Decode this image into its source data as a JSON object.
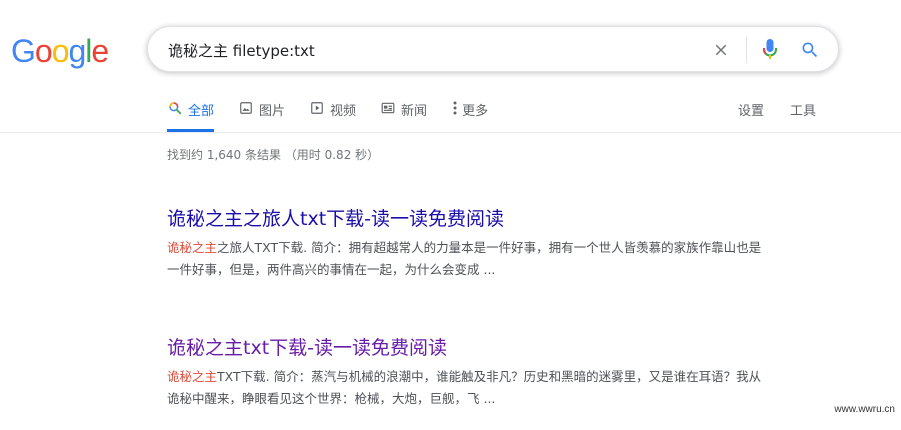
{
  "logo": {
    "letters": [
      {
        "ch": "G",
        "color": "#4285F4"
      },
      {
        "ch": "o",
        "color": "#EA4335"
      },
      {
        "ch": "o",
        "color": "#FBBC05"
      },
      {
        "ch": "g",
        "color": "#4285F4"
      },
      {
        "ch": "l",
        "color": "#34A853"
      },
      {
        "ch": "e",
        "color": "#EA4335"
      }
    ]
  },
  "search": {
    "query": "诡秘之主 filetype:txt",
    "clear_icon": "close-icon",
    "mic_icon": "mic-icon",
    "search_icon": "search-icon"
  },
  "tabs": [
    {
      "label": "全部",
      "icon": "search-icon",
      "active": true
    },
    {
      "label": "图片",
      "icon": "image-icon",
      "active": false
    },
    {
      "label": "视频",
      "icon": "play-icon",
      "active": false
    },
    {
      "label": "新闻",
      "icon": "news-icon",
      "active": false
    },
    {
      "label": "更多",
      "icon": "more-vert-icon",
      "active": false
    }
  ],
  "tools": {
    "settings": "设置",
    "tools": "工具"
  },
  "stats": "找到约 1,640 条结果 （用时 0.82 秒）",
  "results": [
    {
      "title": "诡秘之主之旅人txt下载-读一读免费阅读",
      "snippet_highlight": "诡秘之主",
      "snippet_rest": "之旅人TXT下载. 简介：拥有超越常人的力量本是一件好事，拥有一个世人皆羡慕的家族作靠山也是一件好事，但是，两件高兴的事情在一起，为什么会变成 ..."
    },
    {
      "title": "诡秘之主txt下载-读一读免费阅读",
      "snippet_highlight": "诡秘之主",
      "snippet_rest": "TXT下载. 简介：蒸汽与机械的浪潮中，谁能触及非凡？历史和黑暗的迷雾里，又是谁在耳语？我从诡秘中醒来，睁眼看见这个世界：枪械，大炮，巨舰，飞 ..."
    }
  ],
  "watermark": "www.wwru.cn",
  "colors": {
    "link": "#1a0dab",
    "visited": "#681da8",
    "active_tab": "#1a73e8",
    "highlight": "#dd4b39"
  }
}
